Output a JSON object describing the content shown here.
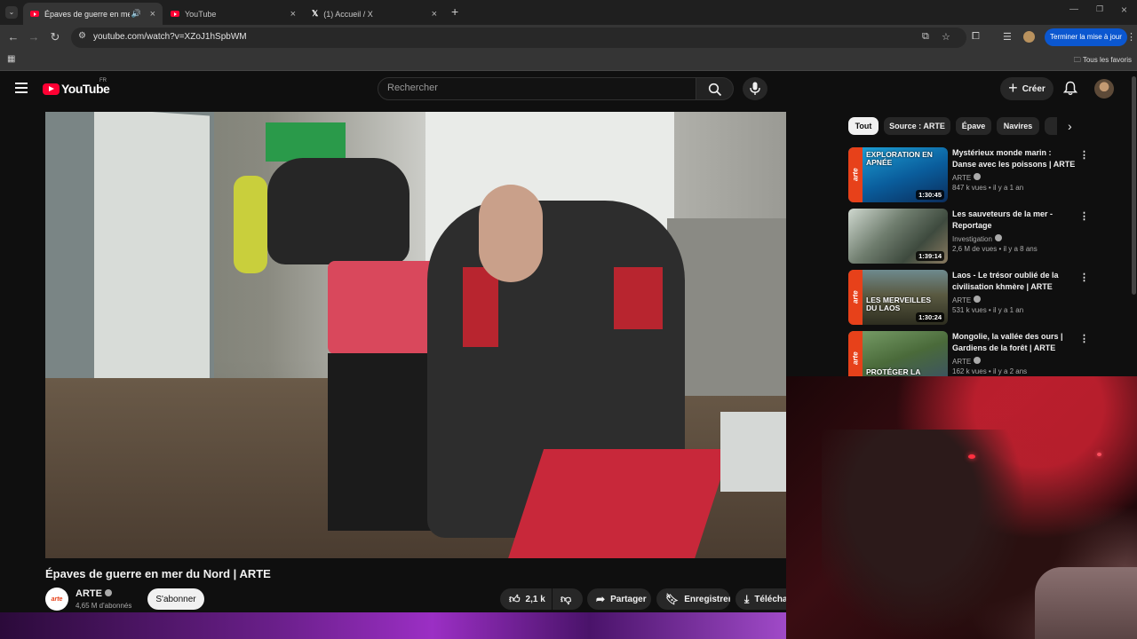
{
  "browser": {
    "tabs": [
      {
        "title": "Épaves de guerre en mer du",
        "active": true
      },
      {
        "title": "YouTube",
        "active": false
      },
      {
        "title": "(1) Accueil / X",
        "active": false
      }
    ],
    "url": "youtube.com/watch?v=XZoJ1hSpbWM",
    "update_button": "Terminer la mise à jour",
    "bookmarks_all": "Tous les favoris"
  },
  "header": {
    "logo_text": "YouTube",
    "country": "FR",
    "search_placeholder": "Rechercher",
    "create_label": "Créer"
  },
  "video": {
    "title": "Épaves de guerre en mer du Nord | ARTE",
    "channel": "ARTE",
    "channel_avatar_text": "arte",
    "subscribers": "4,65 M d'abonnés",
    "subscribe_label": "S'abonner",
    "likes": "2,1 k",
    "share_label": "Partager",
    "save_label": "Enregistrer",
    "download_label": "Télécha"
  },
  "chips": [
    "Tout",
    "Source : ARTE",
    "Épave",
    "Navires"
  ],
  "recommendations": [
    {
      "title": "Mystérieux monde marin : Danse avec les poissons | ARTE",
      "channel": "ARTE",
      "meta": "847 k vues • il y a 1 an",
      "duration": "1:30:45",
      "caption": "EXPLORATION EN APNÉE",
      "arte": true
    },
    {
      "title": "Les sauveteurs de la mer - Reportage",
      "channel": "Investigation",
      "meta": "2,6 M de vues • il y a 8 ans",
      "duration": "1:39:14",
      "caption": "",
      "arte": false
    },
    {
      "title": "Laos - Le trésor oublié de la civilisation khmère | ARTE",
      "channel": "ARTE",
      "meta": "531 k vues • il y a 1 an",
      "duration": "1:30:24",
      "caption": "LES MERVEILLES DU LAOS",
      "arte": true
    },
    {
      "title": "Mongolie, la vallée des ours | Gardiens de la forêt | ARTE",
      "channel": "ARTE",
      "meta": "162 k vues • il y a 2 ans",
      "duration": "",
      "caption": "PROTÉGER LA",
      "arte": true
    }
  ],
  "thumb_arte_label": "arte"
}
